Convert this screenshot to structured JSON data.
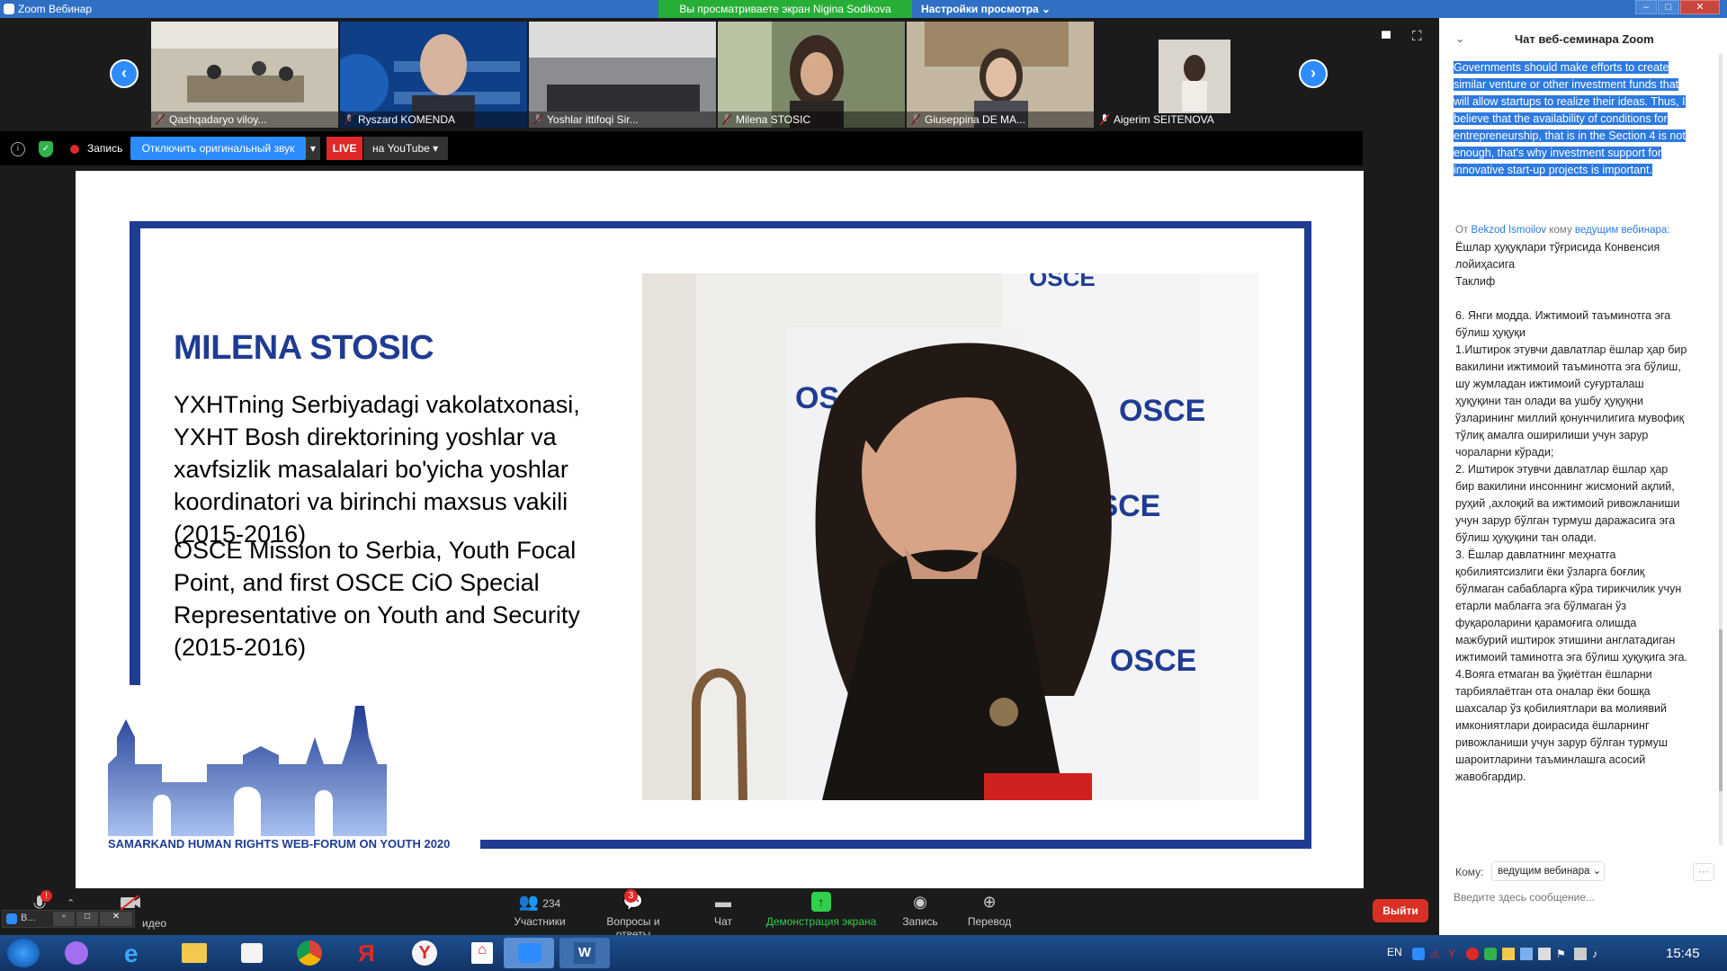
{
  "window": {
    "title": "Zoom Вебинар",
    "share_banner": "Вы просматриваете экран Nigina Sodikova",
    "view_settings": "Настройки просмотра"
  },
  "participants_strip": [
    {
      "name": "Qashqadaryo viloy..."
    },
    {
      "name": "Ryszard KOMENDA"
    },
    {
      "name": "Yoshlar ittifoqi Sir..."
    },
    {
      "name": "Milena STOSIC"
    },
    {
      "name": "Giuseppina DE MA..."
    },
    {
      "name": "Aigerim SEITENOVA"
    }
  ],
  "status_bar": {
    "recording_label": "Запись",
    "unmute_label": "Отключить оригинальный звук",
    "live_label": "LIVE",
    "stream_target": "на YouTube"
  },
  "slide": {
    "name": "MILENA STOSIC",
    "bio_uz": "YXHTning Serbiyadagi vakolatxonasi, YXHT Bosh direktorining yoshlar va xavfsizlik masalalari bo'yicha yoshlar koordinatori va birinchi maxsus vakili (2015-2016)",
    "bio_en": "OSCE Mission to Serbia, Youth Focal Point, and first OSCE CiO Special Representative on Youth and Security (2015-2016)",
    "forum_caption": "SAMARKAND HUMAN RIGHTS WEB-FORUM ON YOUTH 2020",
    "photo_banner_words": [
      "OSCE",
      "OSCE",
      "OSCE",
      "OSCE",
      "OSCE"
    ]
  },
  "chat": {
    "title": "Чат веб-семинара Zoom",
    "selected_text": "Governments should make efforts to create similar venture or other investment funds that will allow startups to realize their ideas.  Thus, I believe that  the availability of conditions for entrepreneurship, that is in the Section 4 is not enough, that's why investment support for innovative start-up projects is important.",
    "from_prefix": "От",
    "from_name": "Bekzod Ismoilov",
    "to_word": "кому",
    "to_name": "ведущим вебинара:",
    "message_body": "Ёшлар ҳуқуқлари тўғрисида Конвенсия лойиҳасига\nТаклиф\n\n6. Янги модда. Ижтимоий таъминотга эга бўлиш ҳуқуқи\n1.Иштирок этувчи давлатлар ёшлар ҳар бир вакилини ижтимоий таъминотга эга бўлиш, шу жумладан ижтимоий суғурталаш ҳуқуқини тан олади ва ушбу ҳуқуқни ўзларининг миллий қонунчилигига мувофиқ тўлиқ амалга оширилиши учун зарур чораларни кўради;\n2. Иштирок этувчи давлатлар ёшлар ҳар бир вакилини инсоннинг жисмоний ақлий, руҳий ,ахлоқий ва ижтимоий ривожланиши учун зарур бўлган турмуш даражасига эга бўлиш ҳуқуқини тан олади.\n3. Ёшлар давлатнинг меҳнатга қобилиятсизлиги ёки ўзларга боғлиқ бўлмаган сабабларга кўра тирикчилик учун етарли маблағга эга бўлмаган ўз фуқароларини қарамоғига олишда мажбурий иштирок этишини англатадиган ижтимоий таминотга эга бўлиш ҳуқуқига эга.\n4.Вояга етмаган ва ўқиётган ёшларни тарбиялаётган ота оналар ёки бошқа шахсалар ўз қобилиятлари ва молиявий имкониятлари доирасида ёшларнинг ривожланиши учун зарур бўлган турмуш шароитларини таъминлашга асосий жавобгардир.",
    "to_label": "Кому:",
    "to_select": "ведущим вебинара",
    "input_placeholder": "Введите здесь сообщение..."
  },
  "toolbar": {
    "video_label": "идео",
    "participants_count": "234",
    "participants_label": "Участники",
    "qa_badge": "3",
    "qa_label": "Вопросы и ответы",
    "chat_label": "Чат",
    "share_label": "Демонстрация экрана",
    "record_label": "Запись",
    "translate_label": "Перевод",
    "exit_label": "Выйти",
    "mic_badge": "!"
  },
  "taskbar": {
    "lang": "EN",
    "time": "15:45",
    "mini_window_label": "В..."
  },
  "colors": {
    "zoom_blue": "#2d8cff",
    "banner_green": "#27ae37",
    "slide_navy": "#1f3c93",
    "exit_red": "#d93025",
    "live_red": "#e02828"
  }
}
